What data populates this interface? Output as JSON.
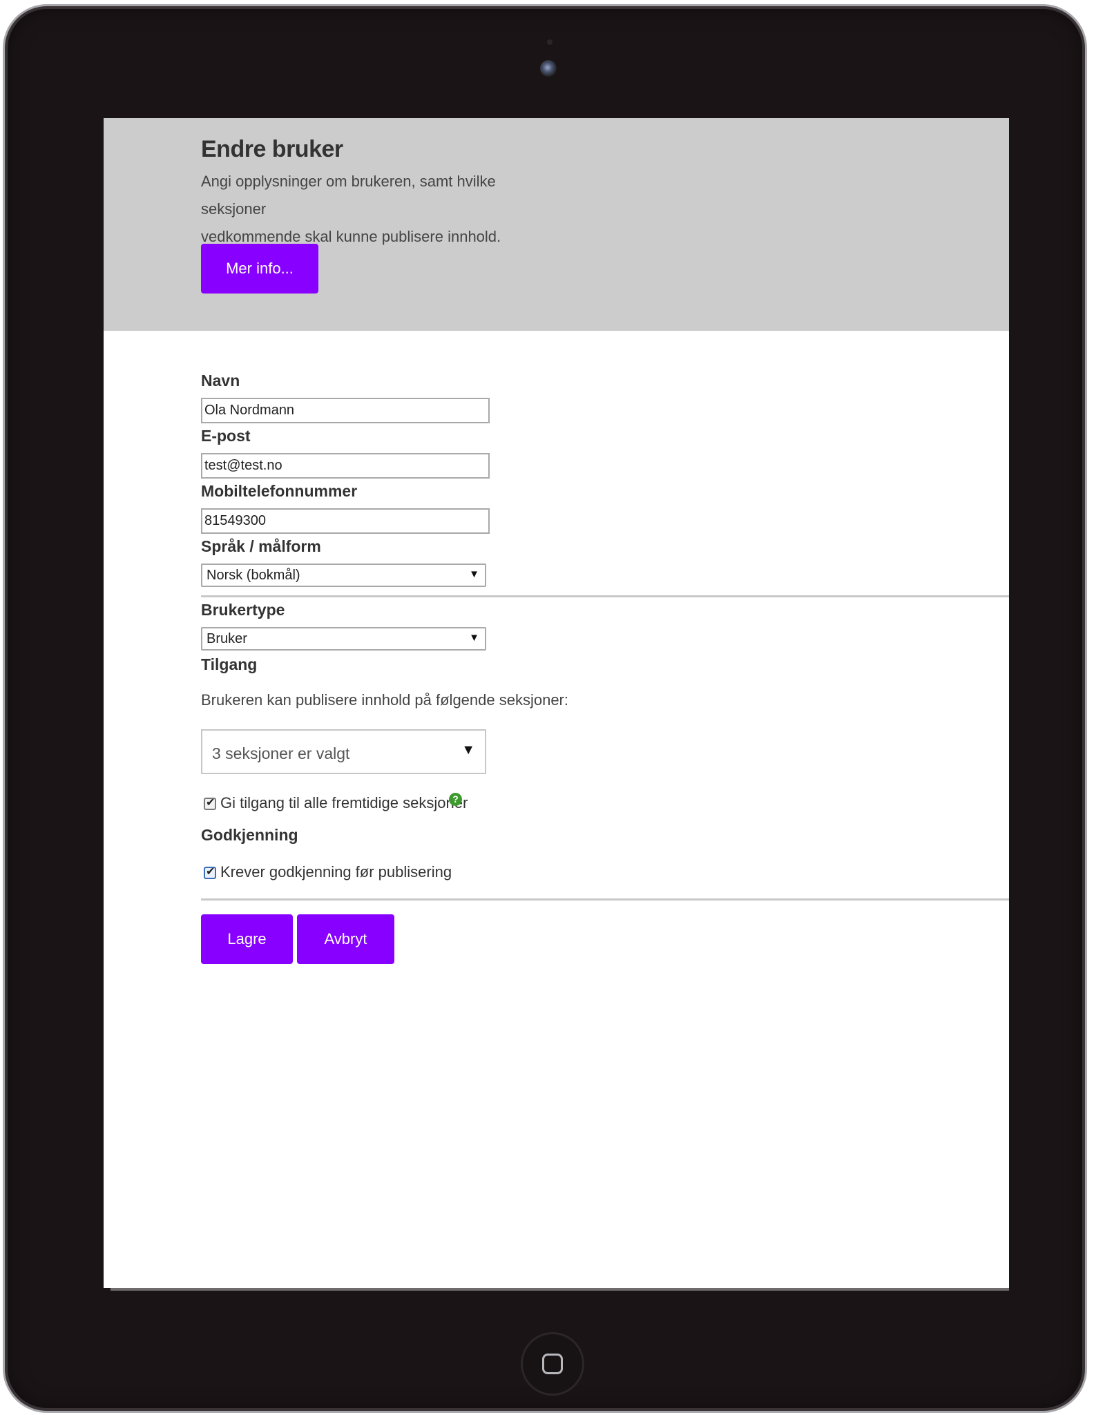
{
  "header": {
    "title": "Endre bruker",
    "intro_line1": "Angi opplysninger om brukeren, samt hvilke seksjoner",
    "intro_line2": "vedkommende skal kunne publisere innhold.",
    "more_info_label": "Mer info..."
  },
  "form": {
    "name": {
      "label": "Navn",
      "value": "Ola Nordmann"
    },
    "email": {
      "label": "E-post",
      "value": "test@test.no"
    },
    "mobile": {
      "label": "Mobiltelefonnummer",
      "value": "81549300"
    },
    "language": {
      "label": "Språk / målform",
      "selected": "Norsk (bokmål)"
    },
    "user_type": {
      "label": "Brukertype",
      "selected": "Bruker"
    },
    "access": {
      "label": "Tilgang",
      "help_text": "Brukeren kan publisere innhold på følgende seksjoner:",
      "sections_selected": "3 seksjoner er valgt",
      "future_sections_label": "Gi tilgang til alle fremtidige seksjoner",
      "future_sections_checked": true,
      "help_icon_glyph": "?"
    },
    "approval": {
      "label": "Godkjenning",
      "requires_approval_label": "Krever godkjenning før publisering",
      "requires_approval_checked": true
    }
  },
  "actions": {
    "save_label": "Lagre",
    "cancel_label": "Avbryt"
  },
  "glyphs": {
    "dropdown_arrow": "▼",
    "check": "✔"
  },
  "colors": {
    "accent": "#8800ff",
    "header_bg": "#cccccc",
    "help_icon": "#3d9a2e"
  },
  "icons": [
    "camera-icon",
    "home-button-icon",
    "help-icon",
    "chevron-down-icon",
    "checkmark-icon"
  ]
}
